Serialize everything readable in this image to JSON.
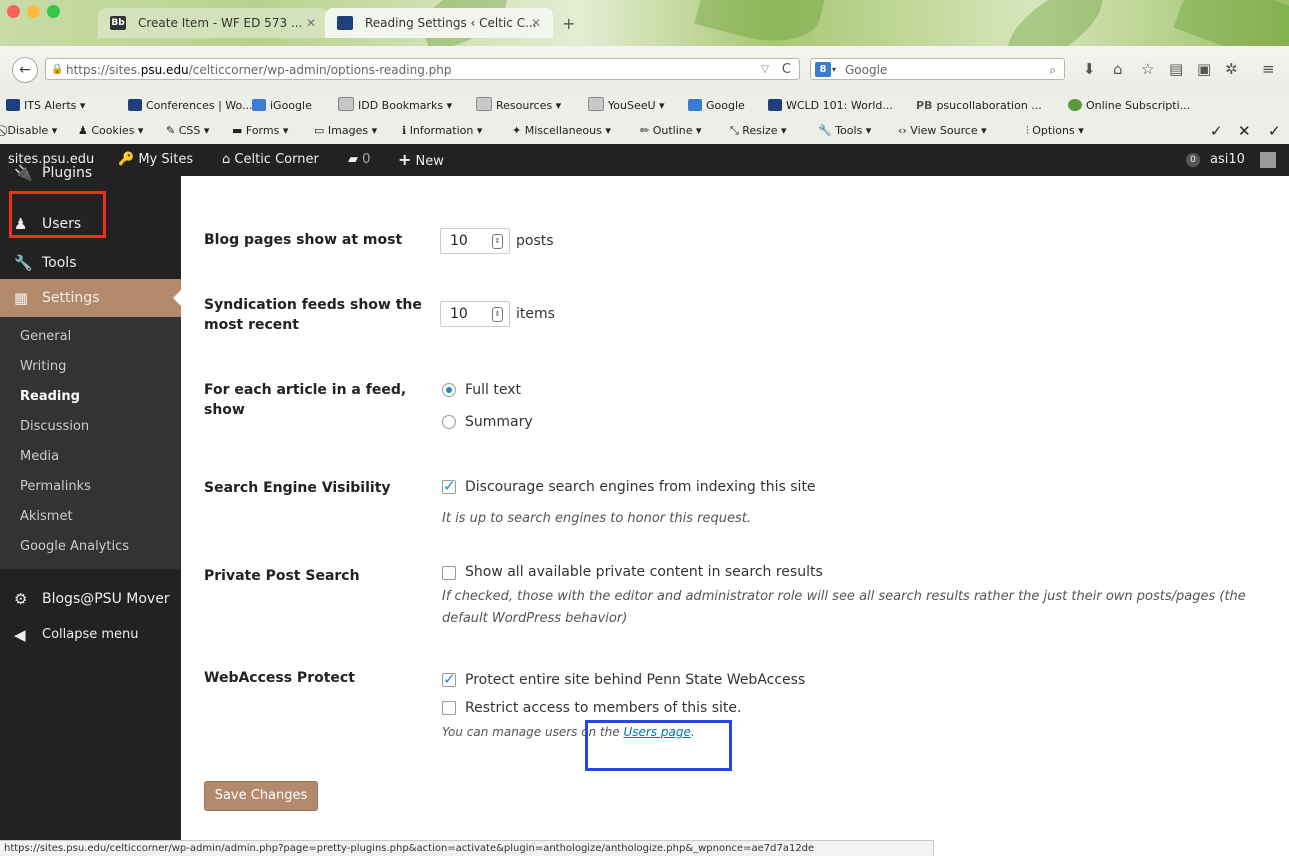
{
  "browser": {
    "tabs": [
      {
        "favicon": "Bb",
        "title": "Create Item - WF ED 573 ...",
        "active": false
      },
      {
        "favicon": "psu-shield",
        "title": "Reading Settings ‹ Celtic C...",
        "active": true
      }
    ],
    "new_tab": "+",
    "url_prefix": "https://sites.",
    "url_domain": "psu.edu",
    "url_suffix": "/celticcorner/wp-admin/options-reading.php",
    "search_placeholder": "Google",
    "search_engine_badge": "8"
  },
  "bookmarks": [
    "ITS Alerts ▾",
    "Conferences | Wo...",
    "iGoogle",
    "IDD Bookmarks ▾",
    "Resources ▾",
    "YouSeeU ▾",
    "Google",
    "WCLD 101: World...",
    "psucollaboration ...",
    "Online Subscripti..."
  ],
  "bookmark_prefix_pb": "PB",
  "dev_toolbar": [
    "Disable ▾",
    "Cookies ▾",
    "CSS ▾",
    "Forms ▾",
    "Images ▾",
    "Information ▾",
    "Miscellaneous ▾",
    "Outline ▾",
    "Resize ▾",
    "Tools ▾",
    "View Source ▾",
    "Options ▾"
  ],
  "admin_bar": {
    "network": "sites.psu.edu",
    "my_sites": "My Sites",
    "site": "Celtic Corner",
    "comments": "0",
    "new": "New",
    "notifications": "0",
    "user": "asi10"
  },
  "sidebar": {
    "plugins": "Plugins",
    "users": "Users",
    "tools": "Tools",
    "settings": "Settings",
    "sub": [
      "General",
      "Writing",
      "Reading",
      "Discussion",
      "Media",
      "Permalinks",
      "Akismet",
      "Google Analytics"
    ],
    "mover": "Blogs@PSU Mover",
    "collapse": "Collapse menu"
  },
  "form": {
    "blog_pages_label": "Blog pages show at most",
    "blog_pages_value": "10",
    "blog_pages_unit": "posts",
    "feeds_label_1": "Syndication feeds show the",
    "feeds_label_2": "most recent",
    "feeds_value": "10",
    "feeds_unit": "items",
    "article_label_1": "For each article in a feed,",
    "article_label_2": "show",
    "full_text": "Full text",
    "summary": "Summary",
    "sev_label": "Search Engine Visibility",
    "sev_option": "Discourage search engines from indexing this site",
    "sev_desc": "It is up to search engines to honor this request.",
    "pps_label": "Private Post Search",
    "pps_option": "Show all available private content in search results",
    "pps_desc_1": "If checked, those with the editor and administrator role will see all search results rather the just their own posts/pages (the",
    "pps_desc_2": "default WordPress behavior)",
    "wap_label": "WebAccess Protect",
    "wap_option_1": "Protect entire site behind Penn State WebAccess",
    "wap_option_2": "Restrict access to members of this site.",
    "wap_desc_pre": "You can manage users on the ",
    "wap_desc_link": "Users page",
    "wap_desc_post": ".",
    "save": "Save Changes"
  },
  "status_url": "https://sites.psu.edu/celticcorner/wp-admin/admin.php?page=pretty-plugins.php&action=activate&plugin=anthologize/anthologize.php&_wpnonce=ae7d7a12de",
  "colors": {
    "wp_dark": "#222222",
    "settings_active": "#b38a6b",
    "highlight_red": "#e8331c",
    "highlight_blue": "#2745e8"
  }
}
